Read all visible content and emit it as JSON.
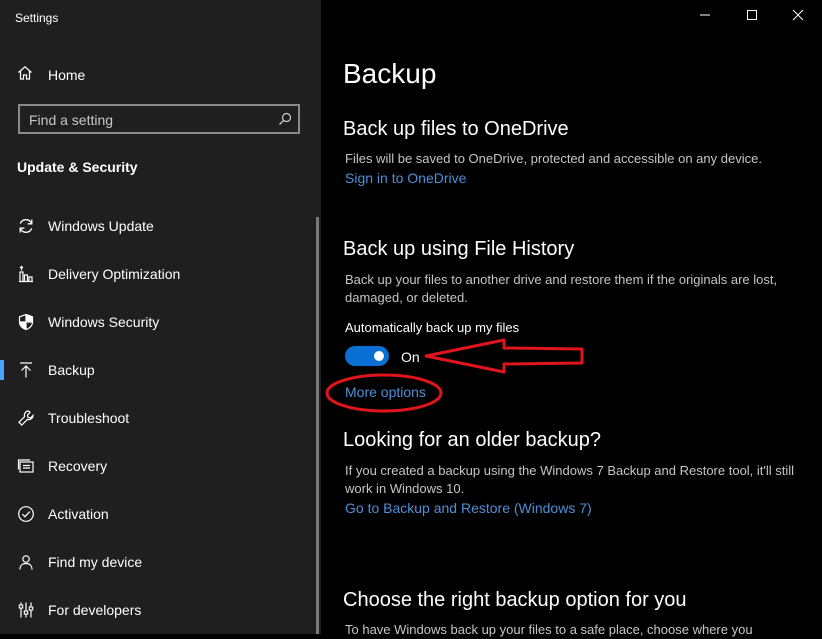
{
  "window": {
    "title": "Settings"
  },
  "sidebar": {
    "home_label": "Home",
    "search_placeholder": "Find a setting",
    "section_title": "Update & Security",
    "items": [
      {
        "label": "Windows Update",
        "icon": "refresh-icon"
      },
      {
        "label": "Delivery Optimization",
        "icon": "delivery-optimization-icon"
      },
      {
        "label": "Windows Security",
        "icon": "shield-icon"
      },
      {
        "label": "Backup",
        "icon": "backup-arrow-icon",
        "active": true
      },
      {
        "label": "Troubleshoot",
        "icon": "wrench-icon"
      },
      {
        "label": "Recovery",
        "icon": "recovery-icon"
      },
      {
        "label": "Activation",
        "icon": "check-circle-icon"
      },
      {
        "label": "Find my device",
        "icon": "person-pin-icon"
      },
      {
        "label": "For developers",
        "icon": "developer-sliders-icon"
      }
    ]
  },
  "main": {
    "title": "Backup",
    "onedrive": {
      "heading": "Back up files to OneDrive",
      "description": "Files will be saved to OneDrive, protected and accessible on any device.",
      "link": "Sign in to OneDrive"
    },
    "file_history": {
      "heading": "Back up using File History",
      "description": "Back up your files to another drive and restore them if the originals are lost, damaged, or deleted.",
      "auto_label": "Automatically back up my files",
      "toggle_state": "On",
      "toggle_on": true,
      "more_options": "More options"
    },
    "older_backup": {
      "heading": "Looking for an older backup?",
      "description": "If you created a backup using the Windows 7 Backup and Restore tool, it'll still work in Windows 10.",
      "link": "Go to Backup and Restore (Windows 7)"
    },
    "choose": {
      "heading": "Choose the right backup option for you",
      "description": "To have Windows back up your files to a safe place, choose where you"
    }
  },
  "colors": {
    "sidebar_bg": "#1f1f1f",
    "main_bg": "#000000",
    "accent": "#0a6fd4",
    "link": "#4f8fd8",
    "annotation": "#e0151b"
  }
}
